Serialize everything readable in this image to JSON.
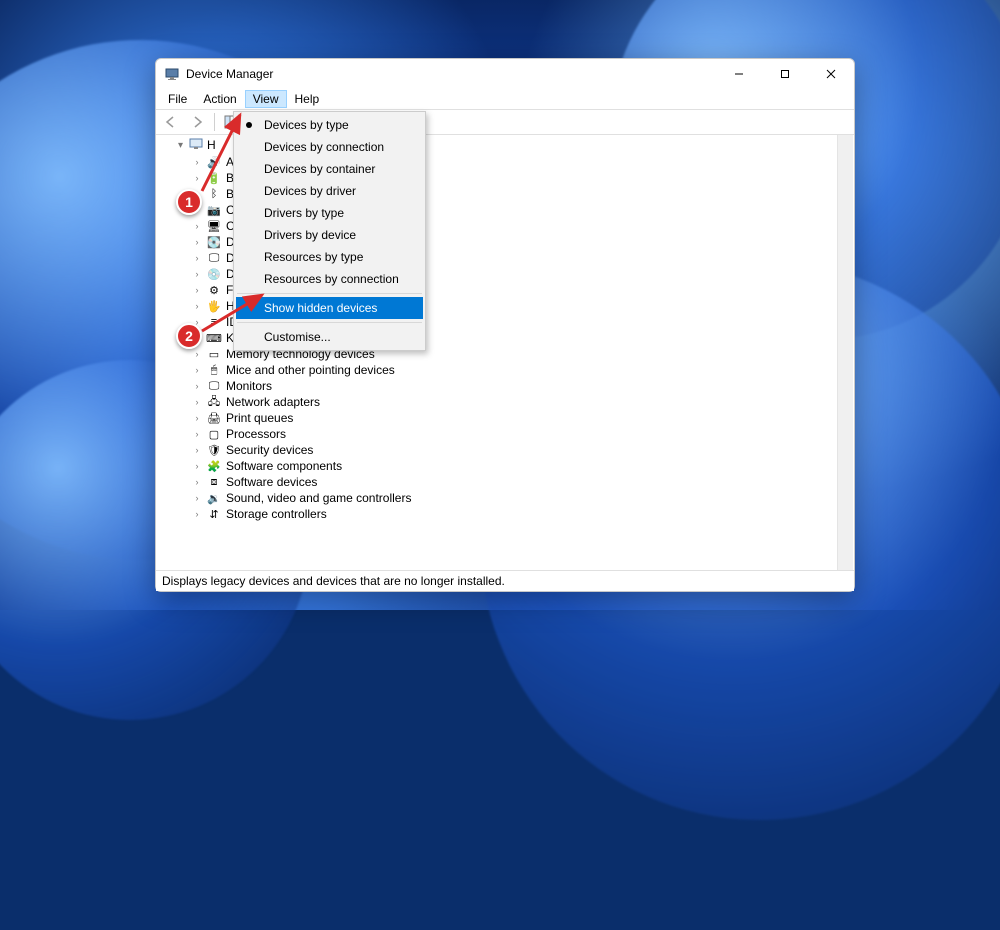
{
  "window": {
    "title": "Device Manager"
  },
  "menubar": {
    "items": [
      "File",
      "Action",
      "View",
      "Help"
    ],
    "active_index": 2
  },
  "view_menu": {
    "items": [
      {
        "label": "Devices by type",
        "checked": true
      },
      {
        "label": "Devices by connection"
      },
      {
        "label": "Devices by container"
      },
      {
        "label": "Devices by driver"
      },
      {
        "label": "Drivers by type"
      },
      {
        "label": "Drivers by device"
      },
      {
        "label": "Resources by type"
      },
      {
        "label": "Resources by connection"
      }
    ],
    "show_hidden": "Show hidden devices",
    "customise": "Customise..."
  },
  "tree": {
    "root_label_partial": "H",
    "nodes": [
      {
        "label_partial": "Aud",
        "icon": "audio-icon"
      },
      {
        "label_partial": "Batt",
        "icon": "battery-icon"
      },
      {
        "label_partial": "Blue",
        "icon": "bluetooth-icon"
      },
      {
        "label_partial": "Cam",
        "icon": "camera-icon"
      },
      {
        "label_partial": "Com",
        "icon": "computer-icon"
      },
      {
        "label_partial": "Disk",
        "icon": "disk-icon"
      },
      {
        "label_partial": "Disp",
        "icon": "display-icon"
      },
      {
        "label_partial": "DVD",
        "icon": "dvd-icon"
      },
      {
        "label_partial": "Firm",
        "icon": "firmware-icon"
      },
      {
        "label_partial": "Hum",
        "icon": "hid-icon"
      },
      {
        "label_partial": "IDE A",
        "icon": "ide-icon"
      },
      {
        "label": "Keyboards",
        "icon": "keyboard-icon"
      },
      {
        "label": "Memory technology devices",
        "icon": "memory-icon"
      },
      {
        "label": "Mice and other pointing devices",
        "icon": "mouse-icon"
      },
      {
        "label": "Monitors",
        "icon": "monitor-icon"
      },
      {
        "label": "Network adapters",
        "icon": "network-icon"
      },
      {
        "label": "Print queues",
        "icon": "printer-icon"
      },
      {
        "label": "Processors",
        "icon": "processor-icon"
      },
      {
        "label": "Security devices",
        "icon": "security-icon"
      },
      {
        "label": "Software components",
        "icon": "software-comp-icon"
      },
      {
        "label": "Software devices",
        "icon": "software-dev-icon"
      },
      {
        "label": "Sound, video and game controllers",
        "icon": "sound-icon"
      },
      {
        "label": "Storage controllers",
        "icon": "storage-icon"
      }
    ]
  },
  "statusbar": {
    "text": "Displays legacy devices and devices that are no longer installed."
  },
  "callouts": {
    "step1": "1",
    "step2": "2"
  }
}
